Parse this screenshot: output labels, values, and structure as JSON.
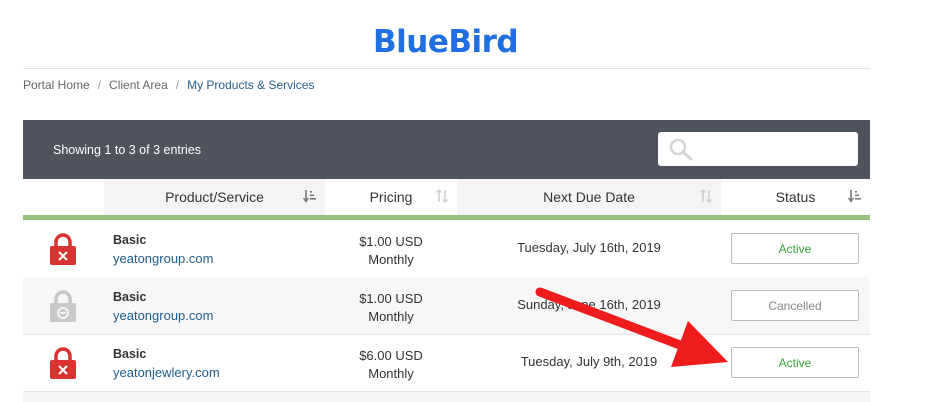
{
  "brand": {
    "logo_text": "BlueBird",
    "color": "#1f6fe0"
  },
  "breadcrumb": {
    "items": [
      "Portal Home",
      "Client Area",
      "My Products & Services"
    ],
    "separator": "/"
  },
  "table": {
    "showing_text": "Showing 1 to 3 of 3 entries",
    "search": {
      "placeholder": "",
      "icon": "search-icon"
    },
    "columns": [
      "Product/Service",
      "Pricing",
      "Next Due Date",
      "Status"
    ],
    "rows": [
      {
        "icon": "lock-red-icon",
        "product": "Basic",
        "domain": "yeatongroup.com",
        "price": "$1.00 USD",
        "cycle": "Monthly",
        "due": "Tuesday, July 16th, 2019",
        "status": "Active"
      },
      {
        "icon": "lock-grey-icon",
        "product": "Basic",
        "domain": "yeatongroup.com",
        "price": "$1.00 USD",
        "cycle": "Monthly",
        "due": "Sunday, June 16th, 2019",
        "status": "Cancelled"
      },
      {
        "icon": "lock-red-icon",
        "product": "Basic",
        "domain": "yeatonjewlery.com",
        "price": "$6.00 USD",
        "cycle": "Monthly",
        "due": "Tuesday, July 9th, 2019",
        "status": "Active"
      }
    ]
  },
  "colors": {
    "header_bar": "#4f535d",
    "accent_green": "#93c37e",
    "active_text": "#3aa53a",
    "link": "#1e5e8c",
    "annotation_arrow": "#ee1c1c"
  }
}
